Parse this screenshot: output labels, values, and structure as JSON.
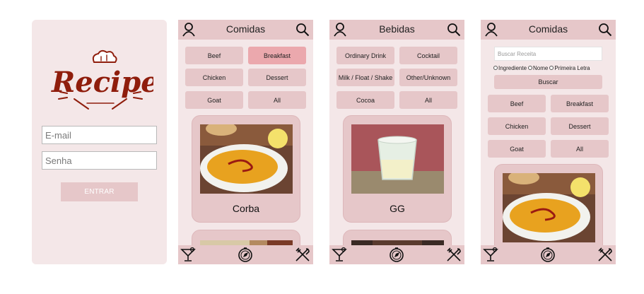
{
  "login": {
    "logo_text": "Recipes",
    "email_placeholder": "E-mail",
    "password_placeholder": "Senha",
    "enter_button": "ENTRAR"
  },
  "foods": {
    "title": "Comidas",
    "categories": [
      "Beef",
      "Breakfast",
      "Chicken",
      "Dessert",
      "Goat",
      "All"
    ],
    "selected_category": "Breakfast",
    "cards": [
      {
        "name": "Corba"
      }
    ]
  },
  "drinks": {
    "title": "Bebidas",
    "categories": [
      "Ordinary Drink",
      "Cocktail",
      "Milk / Float / Shake",
      "Other/Unknown",
      "Cocoa",
      "All"
    ],
    "cards": [
      {
        "name": "GG"
      }
    ]
  },
  "search_screen": {
    "title": "Comidas",
    "search_placeholder": "Buscar Receita",
    "radio_options": [
      "Ingrediente",
      "Nome",
      "Primeira Letra"
    ],
    "search_button": "Buscar",
    "categories": [
      "Beef",
      "Breakfast",
      "Chicken",
      "Dessert",
      "Goat",
      "All"
    ]
  },
  "icons": {
    "profile": "profile-icon",
    "search": "search-icon",
    "drink": "cocktail-icon",
    "explore": "compass-icon",
    "food": "fork-knife-icon"
  },
  "colors": {
    "background": "#f4e7e8",
    "bar": "#e6c7c9",
    "selected": "#eba8ad",
    "logo": "#8f1d0c"
  }
}
